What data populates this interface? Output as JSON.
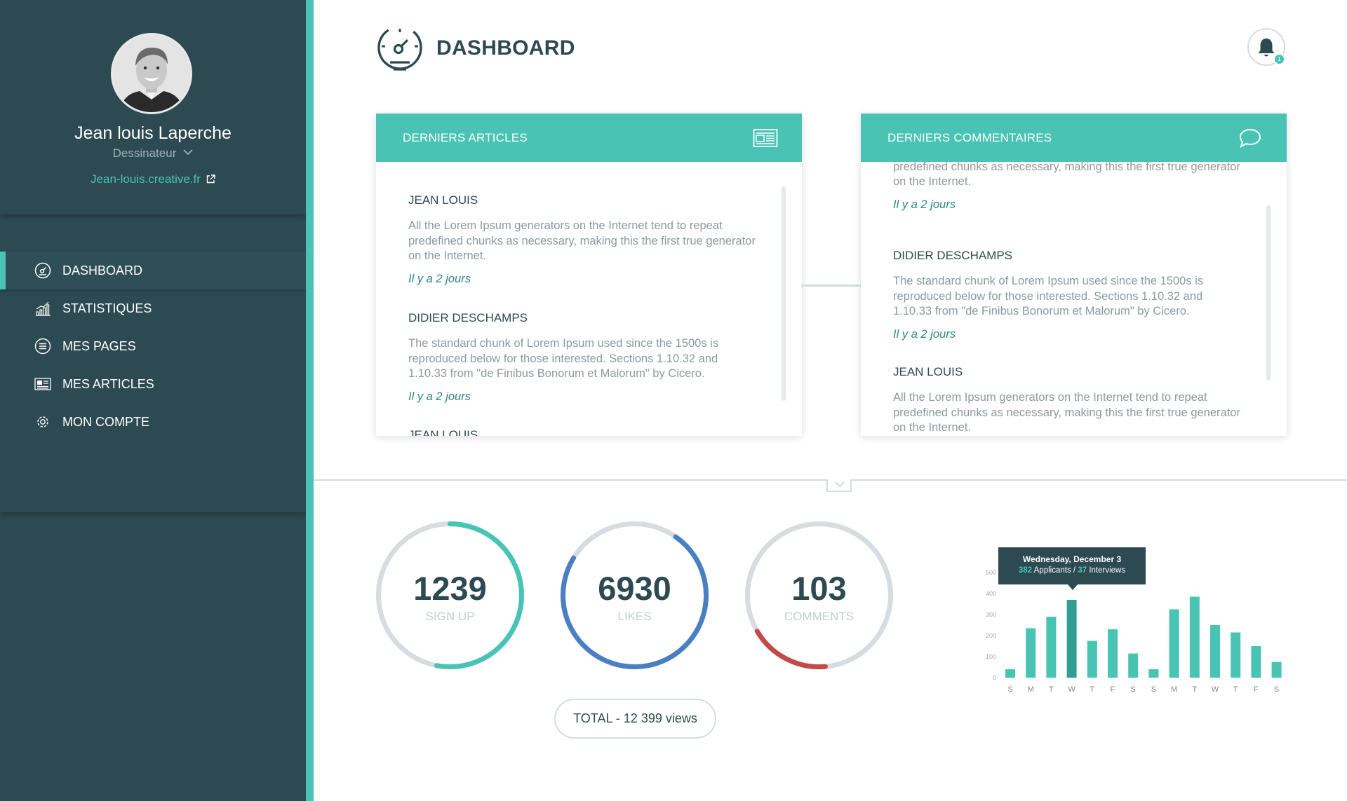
{
  "colors": {
    "sidebar": "#2d4a52",
    "accent": "#48c3b4",
    "likes": "#4a7fc1",
    "comments": "#c44a4a",
    "track": "#d6dce0"
  },
  "profile": {
    "name": "Jean louis Laperche",
    "role": "Dessinateur",
    "website": "Jean-louis.creative.fr"
  },
  "nav": [
    {
      "label": "DASHBOARD",
      "icon": "gauge-icon"
    },
    {
      "label": "STATISTIQUES",
      "icon": "bar-chart-icon"
    },
    {
      "label": "MES PAGES",
      "icon": "list-icon"
    },
    {
      "label": "MES ARTICLES",
      "icon": "newspaper-icon"
    },
    {
      "label": "MON COMPTE",
      "icon": "gear-icon"
    }
  ],
  "header": {
    "title": "DASHBOARD",
    "notification_count": "1"
  },
  "articles": {
    "title": "DERNIERS ARTICLES",
    "items": [
      {
        "author": "JEAN LOUIS",
        "text": "All the Lorem Ipsum generators on the Internet tend to repeat predefined chunks as necessary, making this the first true generator on the Internet.",
        "time": "Il y a 2 jours"
      },
      {
        "author": "DIDIER DESCHAMPS",
        "text": "The standard chunk of Lorem Ipsum used since the 1500s is reproduced below for those interested. Sections 1.10.32 and 1.10.33 from \"de Finibus Bonorum et Malorum\" by Cicero.",
        "time": "Il y a 2 jours"
      },
      {
        "author": "JEAN LOUIS"
      }
    ]
  },
  "comments": {
    "title": "DERNIERS COMMENTAIRES",
    "items": [
      {
        "text": "All the Lorem Ipsum generators on the Internet tend to repeat predefined chunks as necessary, making this the first true generator on the Internet.",
        "time": "Il y a 2 jours"
      },
      {
        "author": "DIDIER DESCHAMPS",
        "text": "The standard chunk of Lorem Ipsum used since the 1500s is reproduced below for those interested. Sections 1.10.32 and 1.10.33 from \"de Finibus Bonorum et Malorum\" by Cicero.",
        "time": "Il y a 2 jours"
      },
      {
        "author": "JEAN LOUIS",
        "text": "All the Lorem Ipsum generators on the Internet tend to repeat predefined chunks as necessary, making this the first true generator on the Internet."
      }
    ]
  },
  "stats": [
    {
      "value": "1239",
      "label": "SIGN UP",
      "progress": 0.53,
      "start_deg": 0,
      "color": "#48c3b4"
    },
    {
      "value": "6930",
      "label": "LIKES",
      "progress": 0.74,
      "start_deg": 35,
      "color": "#4a7fc1"
    },
    {
      "value": "103",
      "label": "COMMENTS",
      "progress": 0.18,
      "start_deg": 175,
      "color": "#c44a4a"
    }
  ],
  "total": "TOTAL - 12 399 views",
  "chart_data": {
    "type": "bar",
    "categories": [
      "S",
      "M",
      "T",
      "W",
      "T",
      "F",
      "S",
      "S",
      "M",
      "T",
      "W",
      "T",
      "F",
      "S"
    ],
    "values": [
      40,
      235,
      290,
      370,
      175,
      230,
      115,
      40,
      325,
      385,
      250,
      215,
      150,
      75
    ],
    "ylim": [
      0,
      500
    ],
    "yticks": [
      0,
      100,
      200,
      300,
      400,
      500
    ],
    "highlight_index": 3,
    "tooltip": {
      "title": "Wednesday, December 3",
      "applicants": "382",
      "applicants_label": "Applicants",
      "separator": "/",
      "interviews": "37",
      "interviews_label": "Interviews"
    }
  }
}
